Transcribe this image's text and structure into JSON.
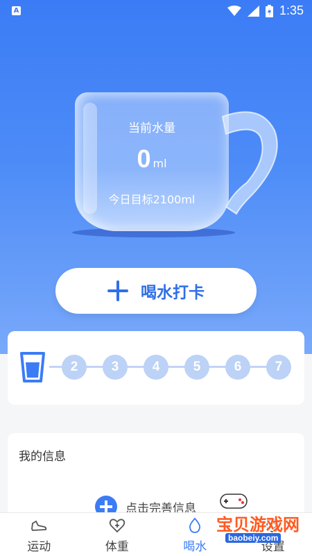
{
  "status_bar": {
    "time": "1:35",
    "app_indicator": "A"
  },
  "cup": {
    "label": "当前水量",
    "amount": "0",
    "unit": "ml",
    "goal_text": "今日目标2100ml"
  },
  "checkin": {
    "label": "喝水打卡"
  },
  "progress": {
    "steps": [
      "2",
      "3",
      "4",
      "5",
      "6",
      "7"
    ]
  },
  "info": {
    "title": "我的信息",
    "action": "点击完善信息"
  },
  "nav": {
    "items": [
      {
        "label": "运动",
        "icon": "shoe-icon"
      },
      {
        "label": "体重",
        "icon": "heart-plus-icon"
      },
      {
        "label": "喝水",
        "icon": "water-drop-icon"
      },
      {
        "label": "设置",
        "icon": "gear-icon"
      }
    ],
    "active_index": 2
  },
  "watermark": {
    "brand": "宝贝游戏网",
    "domain": "baobeiy.com"
  },
  "colors": {
    "accent": "#3b7cf6",
    "step_inactive": "#bcd2f6"
  }
}
